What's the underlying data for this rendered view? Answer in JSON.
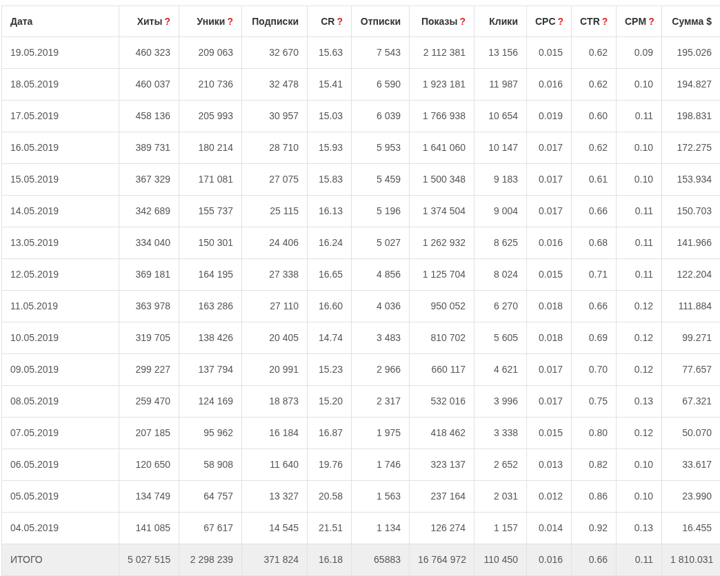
{
  "table": {
    "columns": [
      {
        "label": "Дата"
      },
      {
        "label": "Хиты",
        "hint": "?"
      },
      {
        "label": "Уники",
        "hint": "?"
      },
      {
        "label": "Подписки"
      },
      {
        "label": "CR",
        "hint": "?"
      },
      {
        "label": "Отписки"
      },
      {
        "label": "Показы",
        "hint": "?"
      },
      {
        "label": "Клики"
      },
      {
        "label": "CPC",
        "hint": "?"
      },
      {
        "label": "CTR",
        "hint": "?"
      },
      {
        "label": "CPM",
        "hint": "?"
      },
      {
        "label": "Сумма $"
      }
    ],
    "rows": [
      [
        "19.05.2019",
        "460 323",
        "209 063",
        "32 670",
        "15.63",
        "7 543",
        "2 112 381",
        "13 156",
        "0.015",
        "0.62",
        "0.09",
        "195.026"
      ],
      [
        "18.05.2019",
        "460 037",
        "210 736",
        "32 478",
        "15.41",
        "6 590",
        "1 923 181",
        "11 987",
        "0.016",
        "0.62",
        "0.10",
        "194.827"
      ],
      [
        "17.05.2019",
        "458 136",
        "205 993",
        "30 957",
        "15.03",
        "6 039",
        "1 766 938",
        "10 654",
        "0.019",
        "0.60",
        "0.11",
        "198.831"
      ],
      [
        "16.05.2019",
        "389 731",
        "180 214",
        "28 710",
        "15.93",
        "5 953",
        "1 641 060",
        "10 147",
        "0.017",
        "0.62",
        "0.10",
        "172.275"
      ],
      [
        "15.05.2019",
        "367 329",
        "171 081",
        "27 075",
        "15.83",
        "5 459",
        "1 500 348",
        "9 183",
        "0.017",
        "0.61",
        "0.10",
        "153.934"
      ],
      [
        "14.05.2019",
        "342 689",
        "155 737",
        "25 115",
        "16.13",
        "5 196",
        "1 374 504",
        "9 004",
        "0.017",
        "0.66",
        "0.11",
        "150.703"
      ],
      [
        "13.05.2019",
        "334 040",
        "150 301",
        "24 406",
        "16.24",
        "5 027",
        "1 262 932",
        "8 625",
        "0.016",
        "0.68",
        "0.11",
        "141.966"
      ],
      [
        "12.05.2019",
        "369 181",
        "164 195",
        "27 338",
        "16.65",
        "4 856",
        "1 125 704",
        "8 024",
        "0.015",
        "0.71",
        "0.11",
        "122.204"
      ],
      [
        "11.05.2019",
        "363 978",
        "163 286",
        "27 110",
        "16.60",
        "4 036",
        "950 052",
        "6 270",
        "0.018",
        "0.66",
        "0.12",
        "111.884"
      ],
      [
        "10.05.2019",
        "319 705",
        "138 426",
        "20 405",
        "14.74",
        "3 483",
        "810 702",
        "5 605",
        "0.018",
        "0.69",
        "0.12",
        "99.271"
      ],
      [
        "09.05.2019",
        "299 227",
        "137 794",
        "20 991",
        "15.23",
        "2 966",
        "660 117",
        "4 621",
        "0.017",
        "0.70",
        "0.12",
        "77.657"
      ],
      [
        "08.05.2019",
        "259 470",
        "124 169",
        "18 873",
        "15.20",
        "2 317",
        "532 016",
        "3 996",
        "0.017",
        "0.75",
        "0.13",
        "67.321"
      ],
      [
        "07.05.2019",
        "207 185",
        "95 962",
        "16 184",
        "16.87",
        "1 975",
        "418 462",
        "3 338",
        "0.015",
        "0.80",
        "0.12",
        "50.070"
      ],
      [
        "06.05.2019",
        "120 650",
        "58 908",
        "11 640",
        "19.76",
        "1 746",
        "323 137",
        "2 652",
        "0.013",
        "0.82",
        "0.10",
        "33.617"
      ],
      [
        "05.05.2019",
        "134 749",
        "64 757",
        "13 327",
        "20.58",
        "1 563",
        "237 164",
        "2 031",
        "0.012",
        "0.86",
        "0.10",
        "23.990"
      ],
      [
        "04.05.2019",
        "141 085",
        "67 617",
        "14 545",
        "21.51",
        "1 134",
        "126 274",
        "1 157",
        "0.014",
        "0.92",
        "0.13",
        "16.455"
      ]
    ],
    "total": [
      "ИТОГО",
      "5 027 515",
      "2 298 239",
      "371 824",
      "16.18",
      "65883",
      "16 764 972",
      "110 450",
      "0.016",
      "0.66",
      "0.11",
      "1 810.031"
    ]
  }
}
